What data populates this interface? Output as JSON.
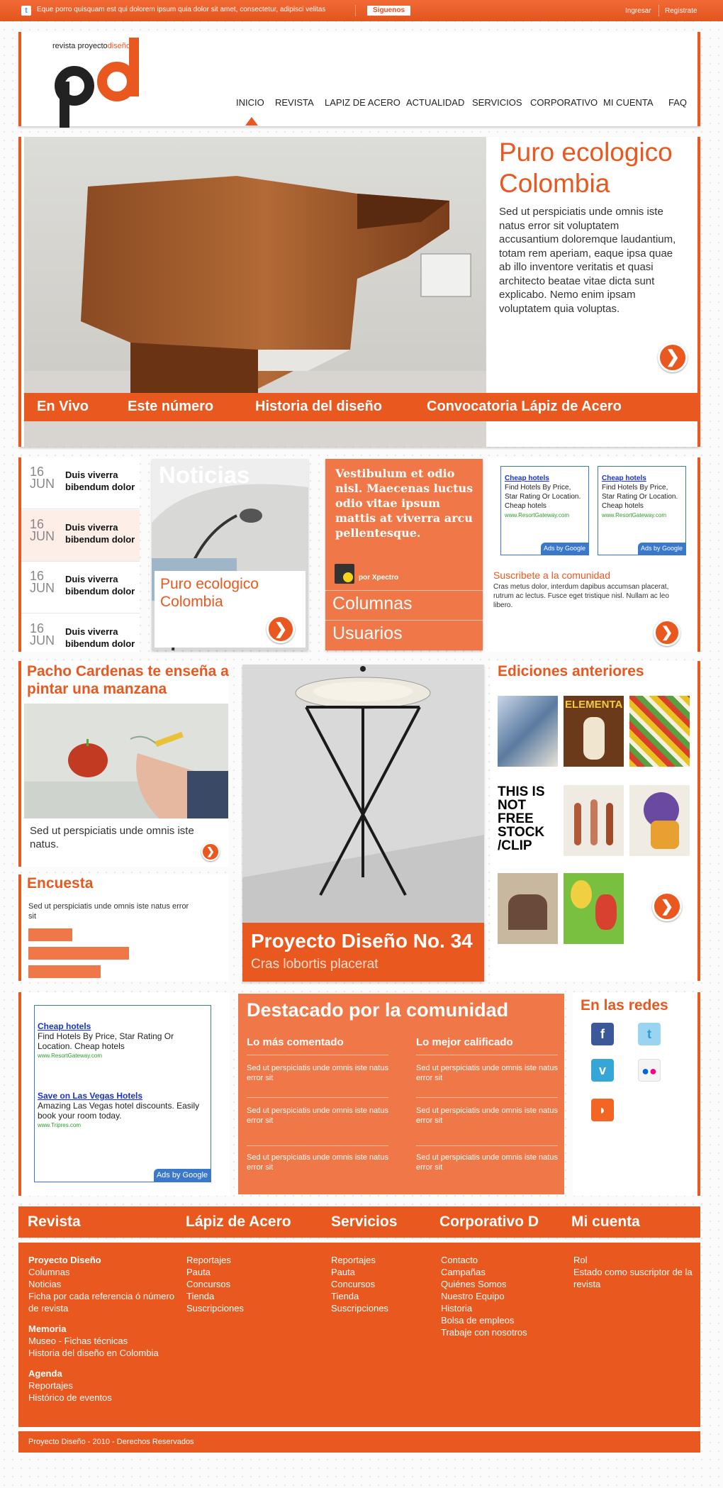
{
  "topbar": {
    "tweet_text": "Eque porro quisquam est qui dolorem ipsum quia dolor sit amet, consectetur, adipisci velitas",
    "follow_label": "Siguenos",
    "login": "Ingresar",
    "register": "Registrate"
  },
  "logo": {
    "brand_prefix": "revista proyecto",
    "brand_accent": "diseño",
    "mark": "pd"
  },
  "nav": {
    "items": [
      "INICIO",
      "REVISTA",
      "LAPIZ DE ACERO",
      "ACTUALIDAD",
      "SERVICIOS",
      "CORPORATIVO",
      "MI CUENTA",
      "FAQ"
    ]
  },
  "hero": {
    "title": "Puro ecologico Colombia",
    "text": "Sed ut perspiciatis unde omnis iste natus error sit voluptatem accusantium doloremque laudantium, totam rem aperiam, eaque ipsa quae ab illo inventore veritatis et quasi architecto beatae vitae dicta sunt explicabo. Nemo enim ipsam voluptatem quia voluptas.",
    "tabs": [
      "En Vivo",
      "Este número",
      "Historia del diseño",
      "Convocatoria Lápiz de Acero"
    ]
  },
  "events": [
    {
      "day": "16",
      "month": "JUN",
      "title": "Duis viverra bibendum dolor"
    },
    {
      "day": "16",
      "month": "JUN",
      "title": "Duis viverra bibendum dolor"
    },
    {
      "day": "16",
      "month": "JUN",
      "title": "Duis viverra bibendum dolor"
    },
    {
      "day": "16",
      "month": "JUN",
      "title": "Duis viverra bibendum dolor"
    }
  ],
  "noticias": {
    "heading": "Noticias",
    "caption": "Puro ecologico Colombia"
  },
  "quote": {
    "text": "Vestibulum et odio nisl. Maecenas luctus odio vitae ipsum mattis at viverra arcu pellentesque.",
    "author": "por Xpectro",
    "links": [
      "Columnas",
      "Usuarios"
    ]
  },
  "ads_small": [
    {
      "title": "Cheap hotels",
      "body": "Find Hotels By Price, Star Rating Or Location. Cheap hotels",
      "url": "www.ResortGateway.com"
    },
    {
      "title": "Cheap hotels",
      "body": "Find Hotels By Price, Star Rating Or Location. Cheap hotels",
      "url": "www.ResortGateway.com"
    }
  ],
  "ads_by": "Ads by Google",
  "subscribe": {
    "title": "Suscribete a la comunidad",
    "text": "Cras metus dolor, interdum dapibus accumsan placerat, rutrum ac lectus. Fusce eget tristique nisl. Nullam ac leo libero."
  },
  "tutorial": {
    "title": "Pacho Cardenas te enseña a pintar una manzana",
    "text": "Sed ut perspiciatis unde omnis iste natus."
  },
  "poll": {
    "title": "Encuesta",
    "question": "Sed ut perspiciatis unde omnis iste natus error sit",
    "bars": [
      0.44,
      1.0,
      0.72
    ]
  },
  "issue": {
    "title": "Proyecto Diseño No. 34",
    "subtitle": "Cras lobortis placerat"
  },
  "ediciones": {
    "title": "Ediciones anteriores",
    "thumb_texts": [
      "ELEMENTA",
      "THIS IS NOT FREE STOCK /CLIP"
    ]
  },
  "ad_large": [
    {
      "title": "Cheap hotels",
      "body": "Find Hotels By Price, Star Rating Or Location. Cheap hotels",
      "url": "www.ResortGateway.com"
    },
    {
      "title": "Save on Las Vegas Hotels",
      "body": "Amazing Las Vegas hotel discounts. Easily book your room today.",
      "url": "www.Tripres.com"
    }
  ],
  "destacado": {
    "title": "Destacado por la comunidad",
    "col1_heading": "Lo más comentado",
    "col2_heading": "Lo mejor calificado",
    "col1": [
      "Sed ut perspiciatis unde omnis iste natus error sit",
      "Sed ut perspiciatis unde omnis iste natus error sit",
      "Sed ut perspiciatis unde omnis iste natus error sit"
    ],
    "col2": [
      "Sed ut perspiciatis unde omnis iste natus error sit",
      "Sed ut perspiciatis unde omnis iste natus error sit",
      "Sed ut perspiciatis unde omnis iste natus error sit"
    ]
  },
  "redes": {
    "title": "En las redes",
    "icons": [
      "facebook-icon",
      "twitter-icon",
      "vimeo-icon",
      "flickr-icon",
      "rss-icon"
    ],
    "colors": {
      "facebook": "#3b5998",
      "twitter": "#58b7e8",
      "vimeo": "#36a6d6",
      "flickr": "#ffffff",
      "rss": "#f26522"
    }
  },
  "footer": {
    "headers": [
      "Revista",
      "Lápiz de Acero",
      "Servicios",
      "Corporativo D",
      "Mi cuenta"
    ],
    "col1": {
      "h1": "Proyecto Diseño",
      "l1": [
        "Columnas",
        "Noticias",
        "Ficha por cada referencia ó número de revista"
      ],
      "h2": "Memoria",
      "l2": [
        "Museo - Fichas técnicas",
        "Historia del diseño en Colombia"
      ],
      "h3": "Agenda",
      "l3": [
        "Reportajes",
        "Histórico de eventos"
      ]
    },
    "col2": [
      "Reportajes",
      "Pauta",
      "Concursos",
      "Tienda",
      "Suscripciones"
    ],
    "col3": [
      "Reportajes",
      "Pauta",
      "Concursos",
      "Tienda",
      "Suscripciones"
    ],
    "col4": [
      "Contacto",
      "Campañas",
      "Quiénes Somos",
      "Nuestro Equipo",
      "Historia",
      "Bolsa de empleos",
      "Trabaje con nosotros"
    ],
    "col5": [
      "Rol",
      "Estado como suscriptor de la revista"
    ],
    "copyright": "Proyecto Diseño - 2010 - Derechos Reservados"
  },
  "colors": {
    "accent": "#e9581f",
    "accent_light": "#f07848"
  }
}
